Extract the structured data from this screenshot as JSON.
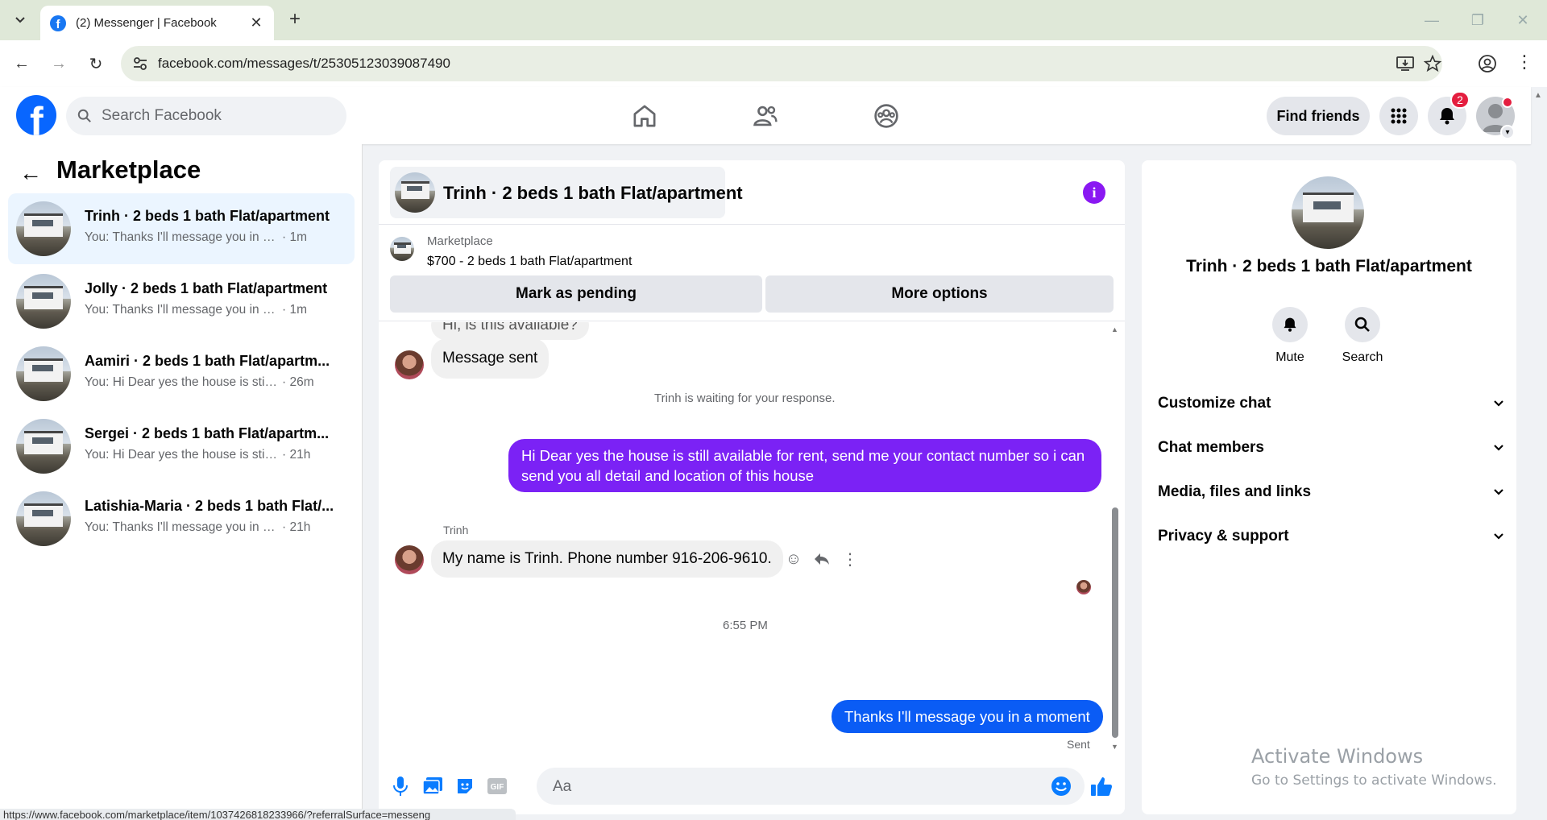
{
  "browser": {
    "tab_title": "(2) Messenger | Facebook",
    "url": "facebook.com/messages/t/25305123039087490",
    "status_url": "https://www.facebook.com/marketplace/item/1037426818233966/?referralSurface=messeng"
  },
  "header": {
    "search_placeholder": "Search Facebook",
    "find_friends_label": "Find friends",
    "notification_count": "2",
    "brand_color": "#0866ff"
  },
  "sidebar": {
    "title": "Marketplace",
    "conversations": [
      {
        "name": "Trinh · 2 beds 1 bath Flat/apartment",
        "preview": "You: Thanks I'll message you in a mo...",
        "time": "· 1m"
      },
      {
        "name": "Jolly · 2 beds 1 bath Flat/apartment",
        "preview": "You: Thanks I'll message you in a mo...",
        "time": "· 1m"
      },
      {
        "name": "Aamiri · 2 beds 1 bath Flat/apartm...",
        "preview": "You: Hi Dear yes the house is still av...",
        "time": "· 26m"
      },
      {
        "name": "Sergei · 2 beds 1 bath Flat/apartm...",
        "preview": "You: Hi Dear yes the house is still ava...",
        "time": "· 21h"
      },
      {
        "name": "Latishia-Maria · 2 beds 1 bath Flat/...",
        "preview": "You: Thanks I'll message you in a mo...",
        "time": "· 21h"
      }
    ]
  },
  "chat": {
    "title": "Trinh · 2 beds 1 bath Flat/apartment",
    "listing_source": "Marketplace",
    "listing_price_title": "$700 - 2 beds 1 bath Flat/apartment",
    "mark_pending_label": "Mark as pending",
    "more_options_label": "More options",
    "msg_partial": "Hi, is this available?",
    "msg_auto": "Message sent",
    "waiting_text": "Trinh is waiting for your response.",
    "msg_out_1": "Hi Dear yes the house is still available for rent, send me your contact number so i can send you all detail and location of this house",
    "sender_label": "Trinh",
    "msg_in_2": "My name is Trinh. Phone number 916-206-9610.",
    "timestamp": "6:55 PM",
    "msg_out_2": "Thanks I'll message you in a moment",
    "sent_status": "Sent",
    "composer_placeholder": "Aa",
    "out_color_1": "#7b22f5",
    "out_color_2": "#0a5cf5",
    "accent_color": "#8a18f2"
  },
  "info_panel": {
    "name": "Trinh · 2 beds 1 bath Flat/apartment",
    "mute_label": "Mute",
    "search_label": "Search",
    "sections": [
      "Customize chat",
      "Chat members",
      "Media, files and links",
      "Privacy & support"
    ]
  },
  "watermark": {
    "line1": "Activate Windows",
    "line2": "Go to Settings to activate Windows."
  }
}
